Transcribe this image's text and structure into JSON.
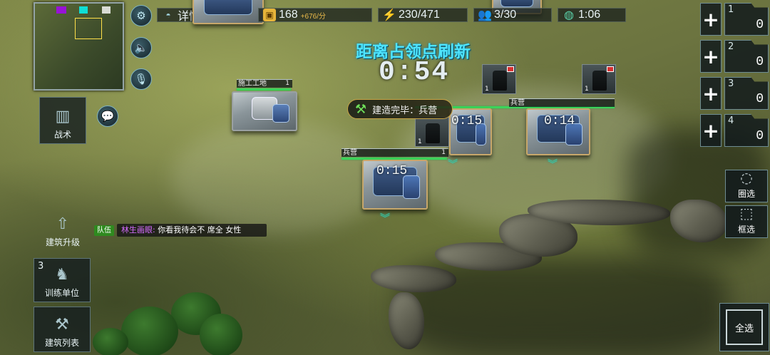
{
  "minimap": {},
  "top_bar": {
    "details_label": "详情",
    "gold": "168",
    "gold_rate": "+676/分",
    "energy": "230/471",
    "population": "3/30",
    "game_time": "1:06"
  },
  "left_panel": {
    "tactics_label": "战术",
    "building_upgrade_label": "建筑升级",
    "train_units_label": "训练单位",
    "train_units_count": "3",
    "building_list_label": "建筑列表"
  },
  "capture_point": {
    "title": "距离占领点刷新",
    "timer": "0:54"
  },
  "toast": {
    "message": "建造完毕：兵营"
  },
  "buildings": [
    {
      "name": "施工工地",
      "level": "1",
      "timer": ""
    },
    {
      "name": "兵营",
      "level": "1",
      "timer": "0:15"
    },
    {
      "name": "兵营",
      "level": "1",
      "timer": "0:15"
    },
    {
      "name": "兵营",
      "level": "1",
      "timer": "0:14"
    }
  ],
  "unit_cards": [
    {
      "count": "1"
    },
    {
      "count": "1"
    },
    {
      "count": "1"
    }
  ],
  "chat": {
    "channel": "队伍",
    "sender": "林生画眼:",
    "text": "你看我待会不   席全    女性"
  },
  "right_panel": {
    "queues": [
      {
        "index": "1",
        "count": "0"
      },
      {
        "index": "2",
        "count": "0"
      },
      {
        "index": "3",
        "count": "0"
      },
      {
        "index": "4",
        "count": "0"
      }
    ],
    "lasso_label": "圈选",
    "box_select_label": "框选",
    "select_all_label": "全选"
  },
  "colors": {
    "capture_title": "#4ee5ff",
    "hp_green": "#3bd45a",
    "gold_rate": "#e9b94a",
    "chat_sender": "#d56cff"
  }
}
